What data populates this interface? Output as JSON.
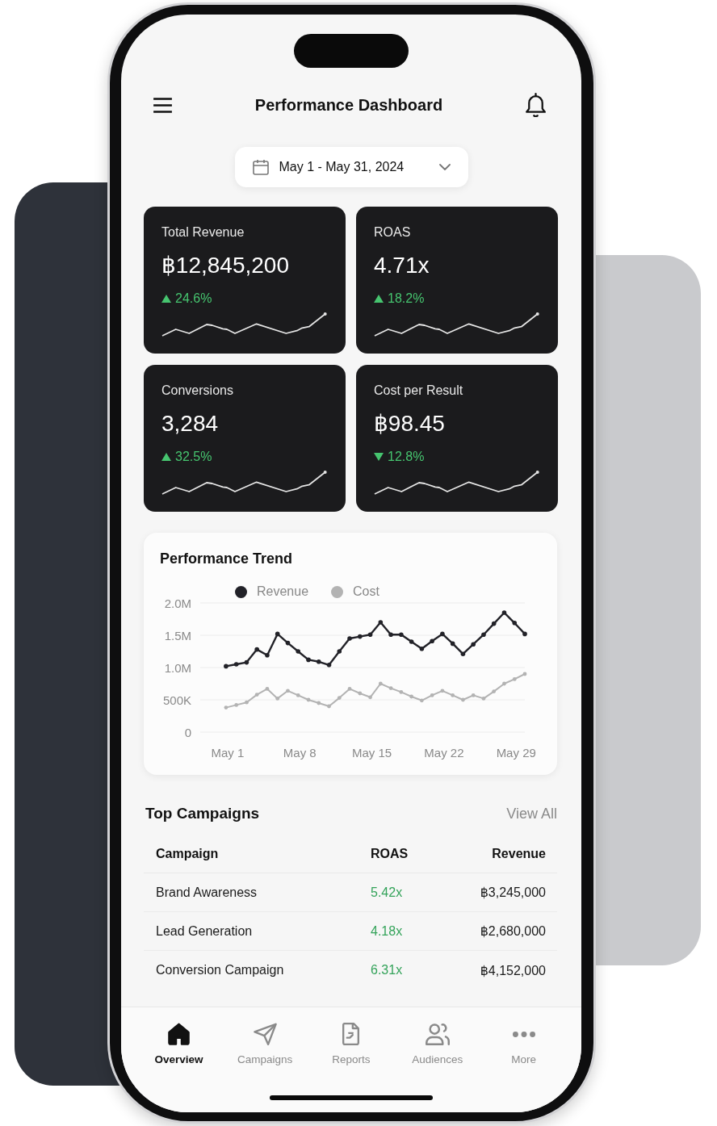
{
  "header": {
    "title": "Performance Dashboard"
  },
  "date_range": {
    "label": "May 1 - May 31, 2024"
  },
  "kpi_cards": [
    {
      "label": "Total Revenue",
      "value": "฿12,845,200",
      "change": "24.6%",
      "up": true
    },
    {
      "label": "ROAS",
      "value": "4.71x",
      "change": "18.2%",
      "up": true
    },
    {
      "label": "Conversions",
      "value": "3,284",
      "change": "32.5%",
      "up": true
    },
    {
      "label": "Cost per Result",
      "value": "฿98.45",
      "change": "12.8%",
      "up": false
    }
  ],
  "trend": {
    "title": "Performance Trend",
    "chart_data": {
      "type": "line",
      "grid": true,
      "categories": [
        "May 1",
        null,
        null,
        null,
        null,
        null,
        null,
        "May 8",
        null,
        null,
        null,
        null,
        null,
        null,
        "May 15",
        null,
        null,
        null,
        null,
        null,
        null,
        "May 22",
        null,
        null,
        null,
        null,
        null,
        null,
        "May 29",
        null
      ],
      "series": [
        {
          "name": "Revenue",
          "color": "#222228",
          "values": [
            1020000,
            1050000,
            1080000,
            1280000,
            1190000,
            1520000,
            1380000,
            1250000,
            1120000,
            1090000,
            1040000,
            1250000,
            1450000,
            1480000,
            1510000,
            1700000,
            1510000,
            1510000,
            1400000,
            1290000,
            1410000,
            1520000,
            1370000,
            1210000,
            1360000,
            1510000,
            1680000,
            1850000,
            1690000,
            1520000
          ]
        },
        {
          "name": "Cost",
          "color": "#b3b3b3",
          "values": [
            380000,
            420000,
            460000,
            580000,
            670000,
            520000,
            640000,
            570000,
            500000,
            450000,
            400000,
            530000,
            670000,
            600000,
            540000,
            750000,
            680000,
            620000,
            550000,
            490000,
            570000,
            640000,
            570000,
            500000,
            570000,
            520000,
            630000,
            750000,
            820000,
            900000
          ]
        }
      ],
      "ylim": [
        0,
        2000000
      ],
      "yticks": [
        {
          "value": 0,
          "label": "0"
        },
        {
          "value": 500000,
          "label": "500K"
        },
        {
          "value": 1000000,
          "label": "1.0M"
        },
        {
          "value": 1500000,
          "label": "1.5M"
        },
        {
          "value": 2000000,
          "label": "2.0M"
        }
      ]
    }
  },
  "top_campaigns": {
    "title": "Top Campaigns",
    "link": "View All",
    "columns": [
      "Campaign",
      "ROAS",
      "Revenue"
    ],
    "rows": [
      [
        "Brand Awareness",
        "5.42x",
        "฿3,245,000"
      ],
      [
        "Lead Generation",
        "4.18x",
        "฿2,680,000"
      ],
      [
        "Conversion Campaign",
        "6.31x",
        "฿4,152,000"
      ]
    ]
  },
  "bottom_nav": [
    {
      "label": "Overview",
      "selected": true
    },
    {
      "label": "Campaigns",
      "selected": false
    },
    {
      "label": "Reports",
      "selected": false
    },
    {
      "label": "Audiences",
      "selected": false
    },
    {
      "label": "More",
      "selected": false
    }
  ]
}
